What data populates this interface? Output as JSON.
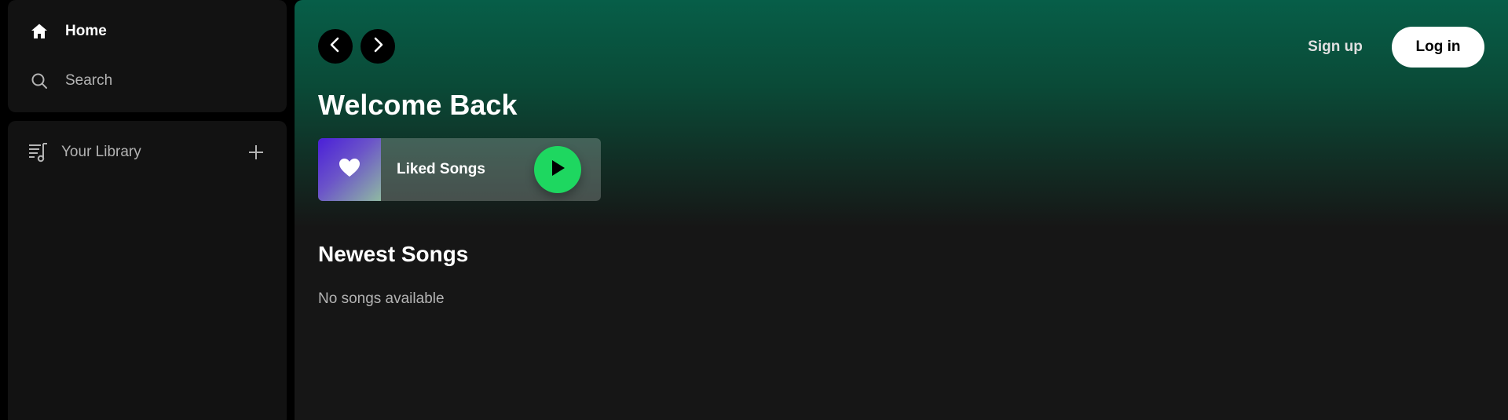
{
  "sidebar": {
    "nav": {
      "home": {
        "label": "Home",
        "icon": "home-icon"
      },
      "search": {
        "label": "Search",
        "icon": "search-icon"
      }
    },
    "library": {
      "label": "Your Library",
      "icon": "library-icon",
      "add_icon": "plus-icon"
    }
  },
  "header": {
    "back_icon": "chevron-left-icon",
    "forward_icon": "chevron-right-icon",
    "signup_label": "Sign up",
    "login_label": "Log in"
  },
  "main": {
    "title": "Welcome Back",
    "liked_songs": {
      "label": "Liked Songs",
      "icon": "heart-icon",
      "play_icon": "play-icon"
    },
    "newest_songs": {
      "title": "Newest Songs",
      "empty_text": "No songs available"
    }
  },
  "colors": {
    "accent_green": "#1ed760",
    "header_gradient_top": "#075e48",
    "panel_bg": "#121212",
    "main_bg": "#161616",
    "muted_text": "#b3b3b3"
  }
}
